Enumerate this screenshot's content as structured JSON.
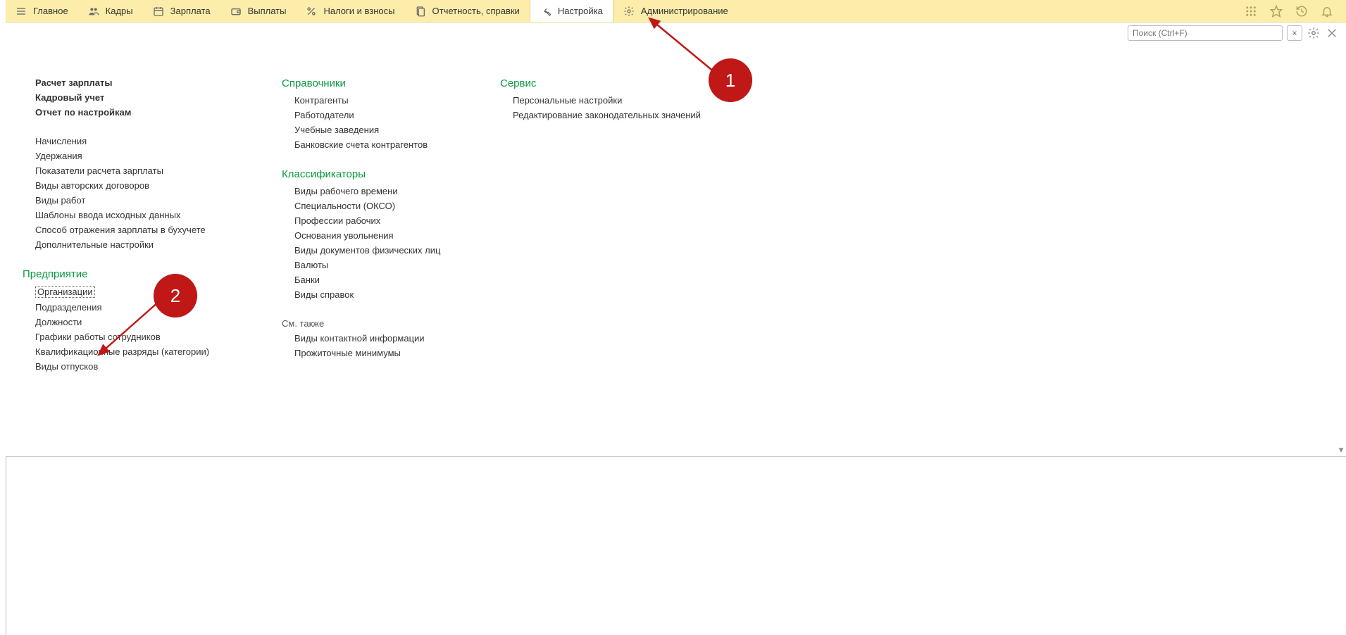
{
  "topnav": {
    "items": [
      {
        "label": "Главное",
        "icon": "menu-icon"
      },
      {
        "label": "Кадры",
        "icon": "people-icon"
      },
      {
        "label": "Зарплата",
        "icon": "calendar-icon"
      },
      {
        "label": "Выплаты",
        "icon": "wallet-icon"
      },
      {
        "label": "Налоги и взносы",
        "icon": "percent-icon"
      },
      {
        "label": "Отчетность, справки",
        "icon": "document-icon"
      },
      {
        "label": "Настройка",
        "icon": "wrench-icon",
        "active": true
      },
      {
        "label": "Администрирование",
        "icon": "gear-icon"
      }
    ]
  },
  "toolbar_right": {
    "icons": [
      "apps-icon",
      "star-icon",
      "history-icon",
      "bell-icon"
    ]
  },
  "search": {
    "placeholder": "Поиск (Ctrl+F)"
  },
  "column1": {
    "bold_links": [
      "Расчет зарплаты",
      "Кадровый учет",
      "Отчет по настройкам"
    ],
    "links_block1": [
      "Начисления",
      "Удержания",
      "Показатели расчета зарплаты",
      "Виды авторских договоров",
      "Виды работ",
      "Шаблоны ввода исходных данных",
      "Способ отражения зарплаты в бухучете",
      "Дополнительные настройки"
    ],
    "section2_title": "Предприятие",
    "section2_selected": "Организации",
    "section2_links": [
      "Подразделения",
      "Должности",
      "Графики работы сотрудников",
      "Квалификационные разряды (категории)",
      "Виды отпусков"
    ]
  },
  "column2": {
    "section1_title": "Справочники",
    "section1_links": [
      "Контрагенты",
      "Работодатели",
      "Учебные заведения",
      "Банковские счета контрагентов"
    ],
    "section2_title": "Классификаторы",
    "section2_links": [
      "Виды рабочего времени",
      "Специальности (ОКСО)",
      "Профессии рабочих",
      "Основания увольнения",
      "Виды документов физических лиц",
      "Валюты",
      "Банки",
      "Виды справок"
    ],
    "see_also_title": "См. также",
    "see_also_links": [
      "Виды контактной информации",
      "Прожиточные минимумы"
    ]
  },
  "column3": {
    "section1_title": "Сервис",
    "section1_links": [
      "Персональные настройки",
      "Редактирование законодательных значений"
    ]
  },
  "annotations": {
    "n1": "1",
    "n2": "2"
  }
}
